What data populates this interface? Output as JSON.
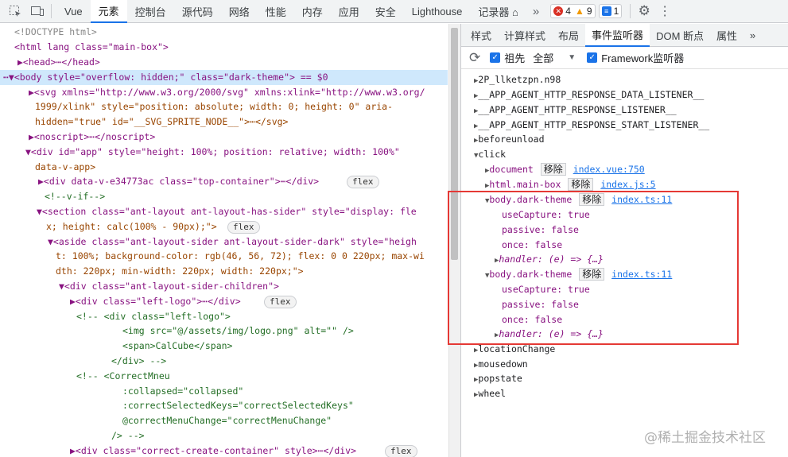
{
  "toolbar": {
    "tabs": [
      "Vue",
      "元素",
      "控制台",
      "源代码",
      "网络",
      "性能",
      "内存",
      "应用",
      "安全",
      "Lighthouse",
      "记录器 ⌂"
    ],
    "active_tab": "元素",
    "more": "»",
    "errors": "4",
    "warnings": "9",
    "messages": "1"
  },
  "elements": {
    "lines": [
      {
        "t": "<!DOCTYPE html>"
      },
      {
        "t": "<html lang class=\"main-box\">"
      },
      {
        "t": "▶<head>⋯</head>"
      },
      {
        "t": "⋯▼<body style=\"overflow: hidden;\" class=\"dark-theme\"> == $0"
      },
      {
        "t": "▶<svg xmlns=\"http://www.w3.org/2000/svg\" xmlns:xlink=\"http://www.w3.org/"
      },
      {
        "t": "1999/xlink\" style=\"position: absolute; width: 0; height: 0\" aria-"
      },
      {
        "t": "hidden=\"true\" id=\"__SVG_SPRITE_NODE__\">⋯</svg>"
      },
      {
        "t": "▶<noscript>⋯</noscript>"
      },
      {
        "t": "▼<div id=\"app\" style=\"height: 100%; position: relative; width: 100%\""
      },
      {
        "t": "data-v-app>"
      },
      {
        "t": "▶<div data-v-e34773ac class=\"top-container\">⋯</div>"
      },
      {
        "t": "<!--v-if-->"
      },
      {
        "t": "▼<section class=\"ant-layout ant-layout-has-sider\" style=\"display: fle"
      },
      {
        "t": "x; height: calc(100% - 90px);\">"
      },
      {
        "t": "▼<aside class=\"ant-layout-sider ant-layout-sider-dark\" style=\"heigh"
      },
      {
        "t": "t: 100%; background-color: rgb(46, 56, 72); flex: 0 0 220px; max-wi"
      },
      {
        "t": "dth: 220px; min-width: 220px; width: 220px;\">"
      },
      {
        "t": "▼<div class=\"ant-layout-sider-children\">"
      },
      {
        "t": "▶<div class=\"left-logo\">⋯</div>"
      },
      {
        "t": "<!-- <div class=\"left-logo\">"
      },
      {
        "t": "<img src=\"@/assets/img/logo.png\" alt=\"\" />"
      },
      {
        "t": "<span>CalCube</span>"
      },
      {
        "t": "</div> -->"
      },
      {
        "t": "<!-- <CorrectMneu"
      },
      {
        "t": ":collapsed=\"collapsed\""
      },
      {
        "t": ":correctSelectedKeys=\"correctSelectedKeys\""
      },
      {
        "t": "@correctMenuChange=\"correctMenuChange\""
      },
      {
        "t": "/> -->"
      },
      {
        "t": "▶<div class=\"correct-create-container\" style>⋯</div>"
      }
    ],
    "pill_flex": "flex",
    "selected_suffix": "== $0"
  },
  "sidebar": {
    "tabs": [
      "样式",
      "计算样式",
      "布局",
      "事件监听器",
      "DOM 断点",
      "属性",
      "»"
    ],
    "active_tab": "事件监听器",
    "refresh_label": "⟳",
    "ancestors_label": "祖先",
    "scope_label": "全部",
    "framework_label": "Framework监听器"
  },
  "listeners": {
    "events": [
      "2P_llketzpn.n98",
      "__APP_AGENT_HTTP_RESPONSE_DATA_LISTENER__",
      "__APP_AGENT_HTTP_RESPONSE_LISTENER__",
      "__APP_AGENT_HTTP_RESPONSE_START_LISTENER__",
      "beforeunload",
      "click",
      "locationChange",
      "mousedown",
      "popstate",
      "wheel"
    ],
    "click_items": [
      {
        "target": "document",
        "remove": "移除",
        "src": "index.vue:750"
      },
      {
        "target": "html.main-box",
        "remove": "移除",
        "src": "index.js:5"
      },
      {
        "target": "body.dark-theme",
        "remove": "移除",
        "src": "index.ts:11"
      },
      {
        "target": "body.dark-theme",
        "remove": "移除",
        "src": "index.ts:11"
      }
    ],
    "props": {
      "useCapture": "useCapture: true",
      "passive": "passive: false",
      "once": "once: false",
      "handler": "handler: (e) => {…}"
    }
  },
  "watermark": "@稀土掘金技术社区"
}
